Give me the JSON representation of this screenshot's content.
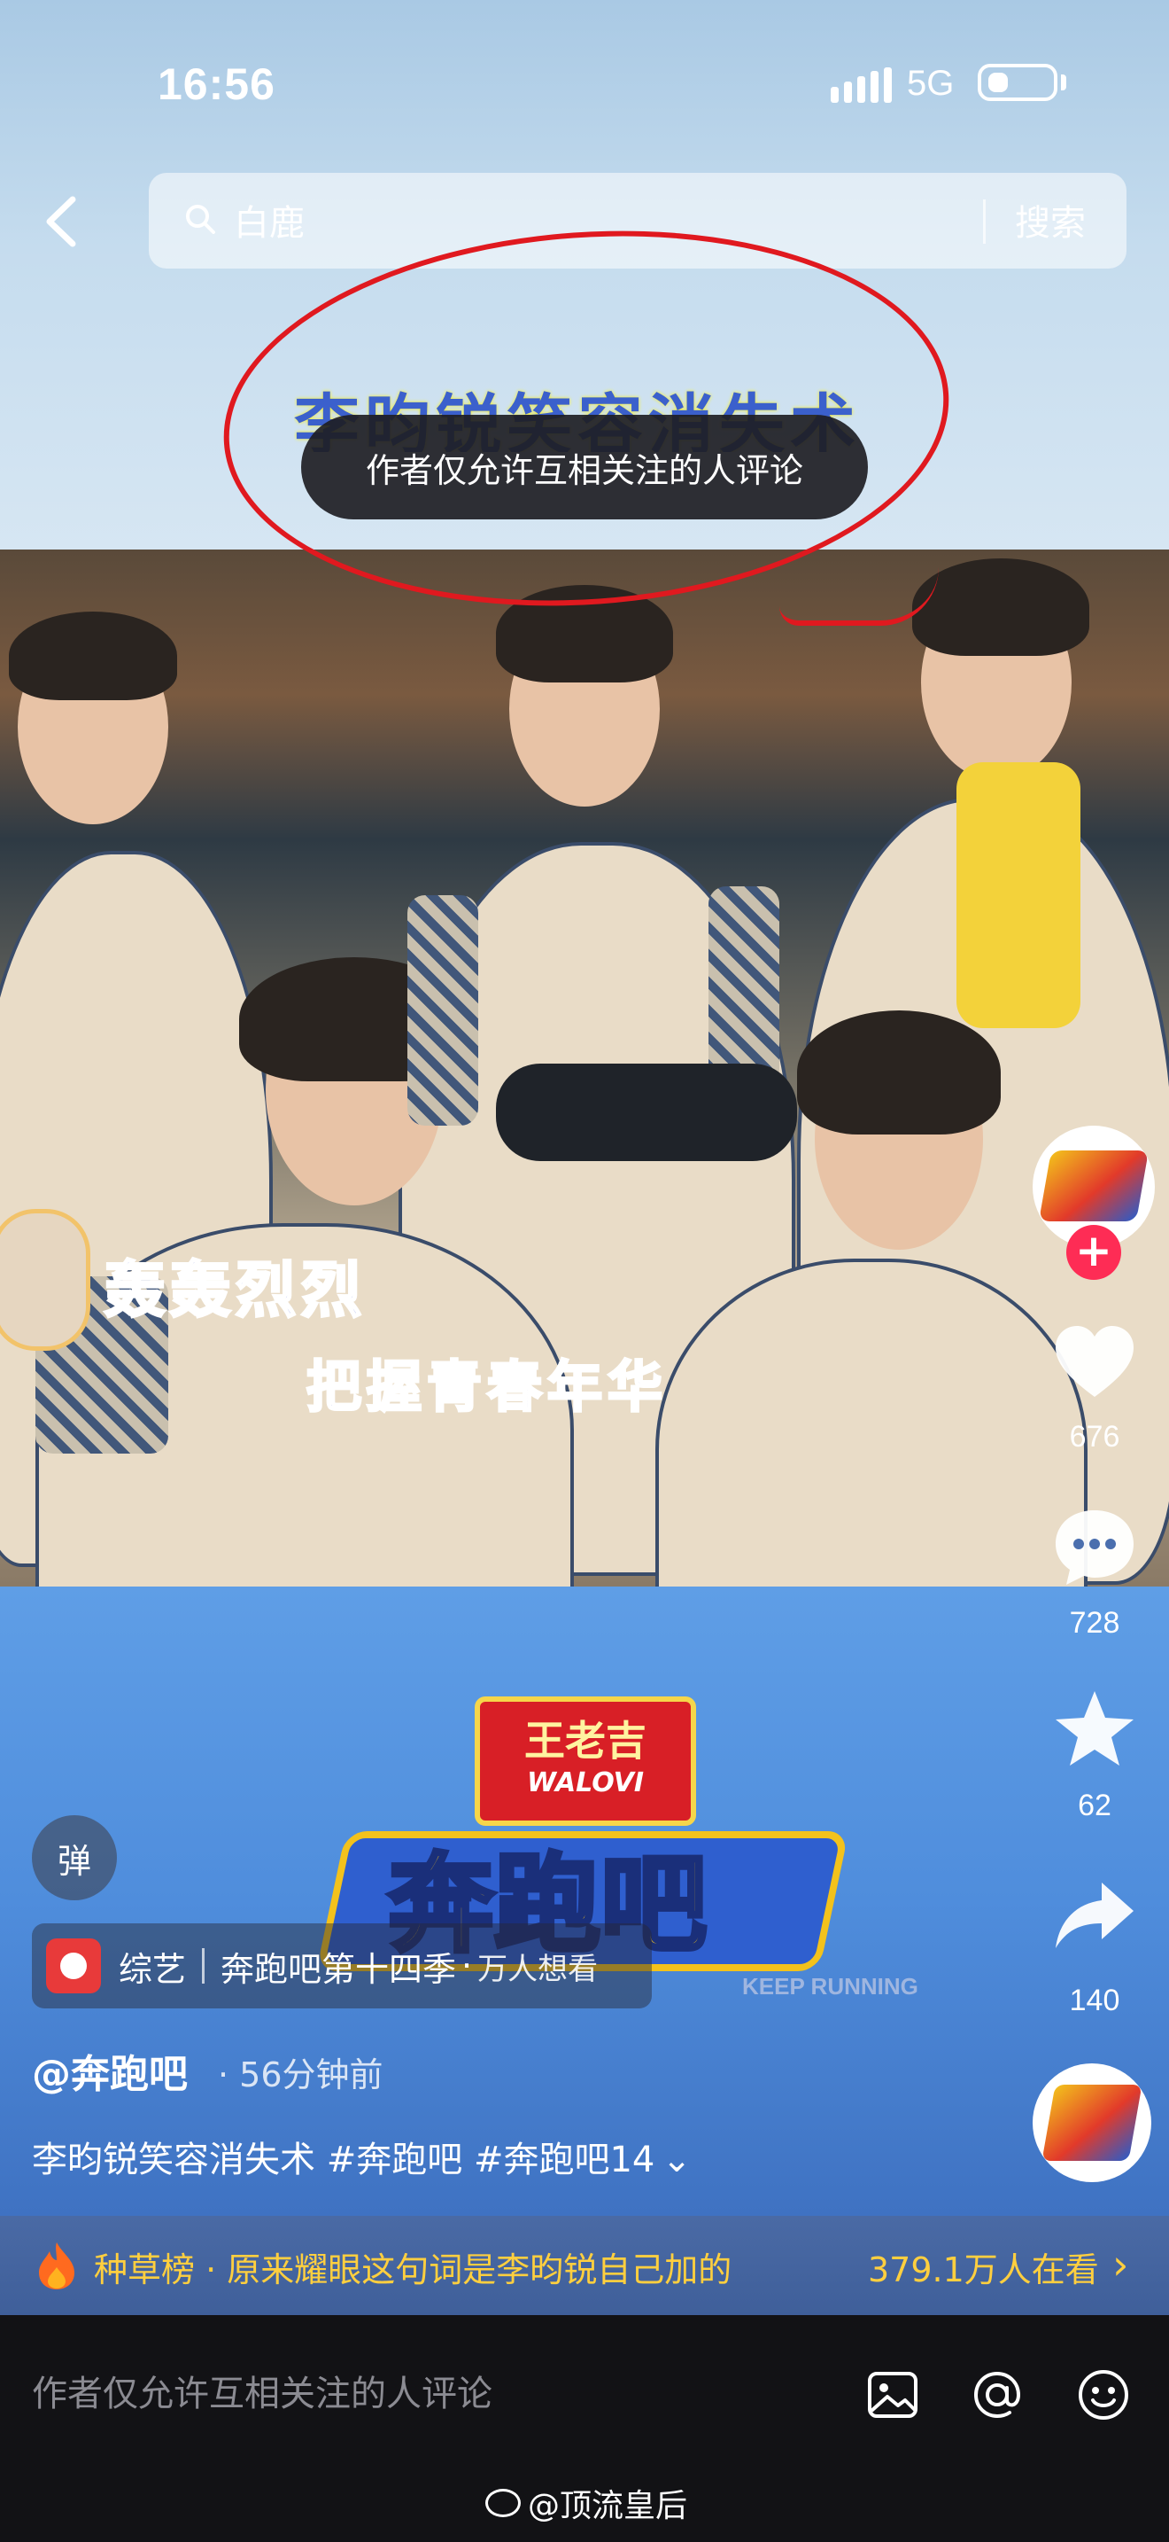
{
  "status_bar": {
    "time": "16:56",
    "network": "5G"
  },
  "search": {
    "query": "白鹿",
    "button": "搜索"
  },
  "video": {
    "headline_partial": "李昀锐笑容消失术",
    "toast": "作者仅允许互相关注的人评论",
    "subtitle_1": "轰轰烈烈",
    "subtitle_2": "把握青春年华",
    "show_logo": {
      "brand_cn": "王老吉",
      "brand_en": "WALOVI",
      "title": "奔跑吧",
      "keep_running": "KEEP RUNNING"
    }
  },
  "actions": {
    "likes": "676",
    "comments": "728",
    "favorites": "62",
    "shares": "140"
  },
  "danmaku": {
    "label": "弹"
  },
  "tag": {
    "category": "综艺",
    "show": "奔跑吧第十四季",
    "viewers": "万人想看"
  },
  "author": {
    "handle": "@奔跑吧",
    "time": "· 56分钟前"
  },
  "description": {
    "text": "李昀锐笑容消失术 #奔跑吧 #奔跑吧14"
  },
  "trending": {
    "label": "种草榜 · 原来耀眼这句词是李昀锐自己加的",
    "count": "379.1万人在看"
  },
  "comment_bar": {
    "placeholder": "作者仅允许互相关注的人评论"
  },
  "watermark": {
    "text": "@顶流皇后"
  },
  "colors": {
    "accent_red": "#fe2c55",
    "annotation_red": "#e0191f",
    "trend_yellow": "#ffcf3f"
  }
}
